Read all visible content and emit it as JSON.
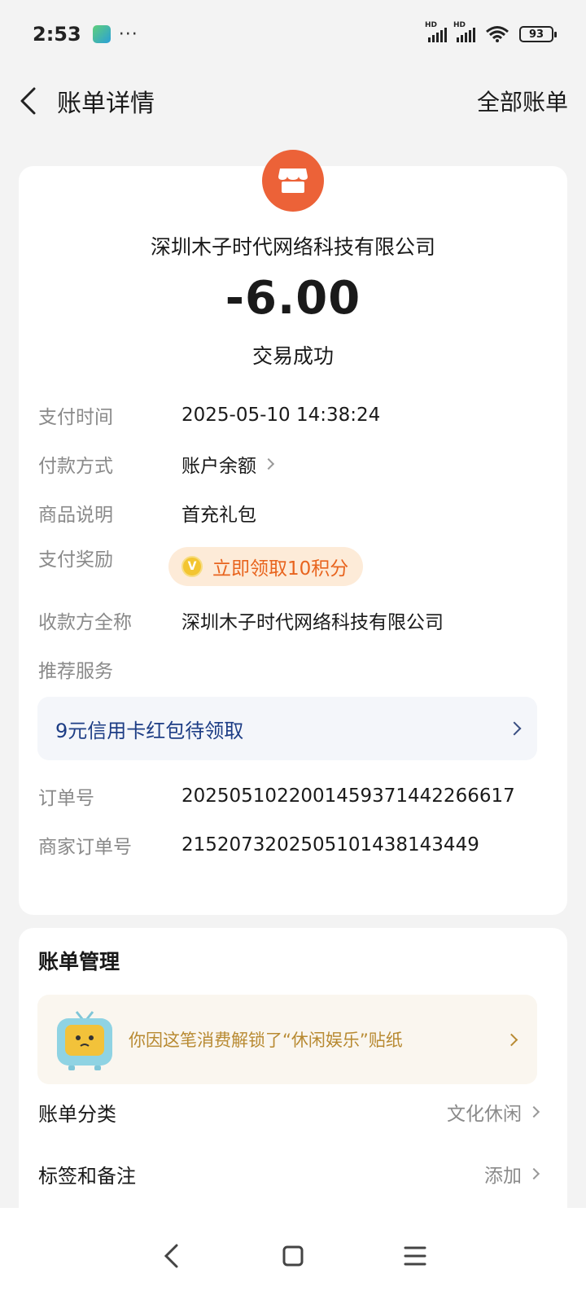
{
  "status_bar": {
    "time": "2:53",
    "more": "···",
    "battery": "93",
    "network_label": "HD"
  },
  "header": {
    "title": "账单详情",
    "all_bills": "全部账单"
  },
  "summary": {
    "merchant_name": "深圳木子时代网络科技有限公司",
    "amount": "-6.00",
    "status": "交易成功",
    "logo_color": "#ec6238"
  },
  "details": {
    "pay_time_label": "支付时间",
    "pay_time_value": "2025-05-10 14:38:24",
    "pay_method_label": "付款方式",
    "pay_method_value": "账户余额",
    "product_label": "商品说明",
    "product_value": "首充礼包",
    "reward_label": "支付奖励",
    "reward_value": "立即领取10积分",
    "reward_coin": "V",
    "payee_label": "收款方全称",
    "payee_value": "深圳木子时代网络科技有限公司",
    "recommend_label": "推荐服务",
    "promo_text": "9元信用卡红包待领取",
    "order_label": "订单号",
    "order_value": "2025051022001459371442266617",
    "merchant_order_label": "商家订单号",
    "merchant_order_value": "2152073202505101438143449"
  },
  "management": {
    "title": "账单管理",
    "sticker_text": "你因这笔消费解锁了“休闲娱乐”贴纸",
    "category_label": "账单分类",
    "category_value": "文化休闲",
    "tags_label": "标签和备注",
    "tags_value": "添加"
  }
}
